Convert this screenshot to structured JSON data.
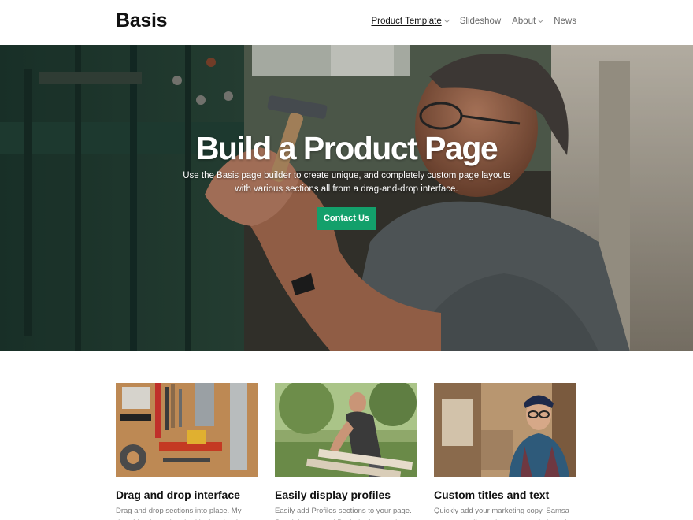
{
  "header": {
    "logo": "Basis",
    "nav": [
      {
        "label": "Product Template",
        "dropdown": true,
        "active": true
      },
      {
        "label": "Slideshow",
        "dropdown": false,
        "active": false
      },
      {
        "label": "About",
        "dropdown": true,
        "active": false
      },
      {
        "label": "News",
        "dropdown": false,
        "active": false
      }
    ]
  },
  "hero": {
    "title": "Build a Product Page",
    "text": "Use the Basis page builder to create unique, and completely custom page layouts with various sections all from a drag-and-drop interface.",
    "cta_label": "Contact Us"
  },
  "features": [
    {
      "title": "Drag and drop interface",
      "text": "Drag and drop sections into place. My dear friend, so absorbed in the, that I neglect my"
    },
    {
      "title": "Easily display profiles",
      "text": "Easily add Profiles sections to your page. Small river named By their place and"
    },
    {
      "title": "Custom titles and text",
      "text": "Quickly add your marketing copy. Samsa was a travelling salesman – and above it there"
    }
  ],
  "colors": {
    "accent": "#13a06b",
    "text": "#111111",
    "muted": "#7a7a7a"
  }
}
